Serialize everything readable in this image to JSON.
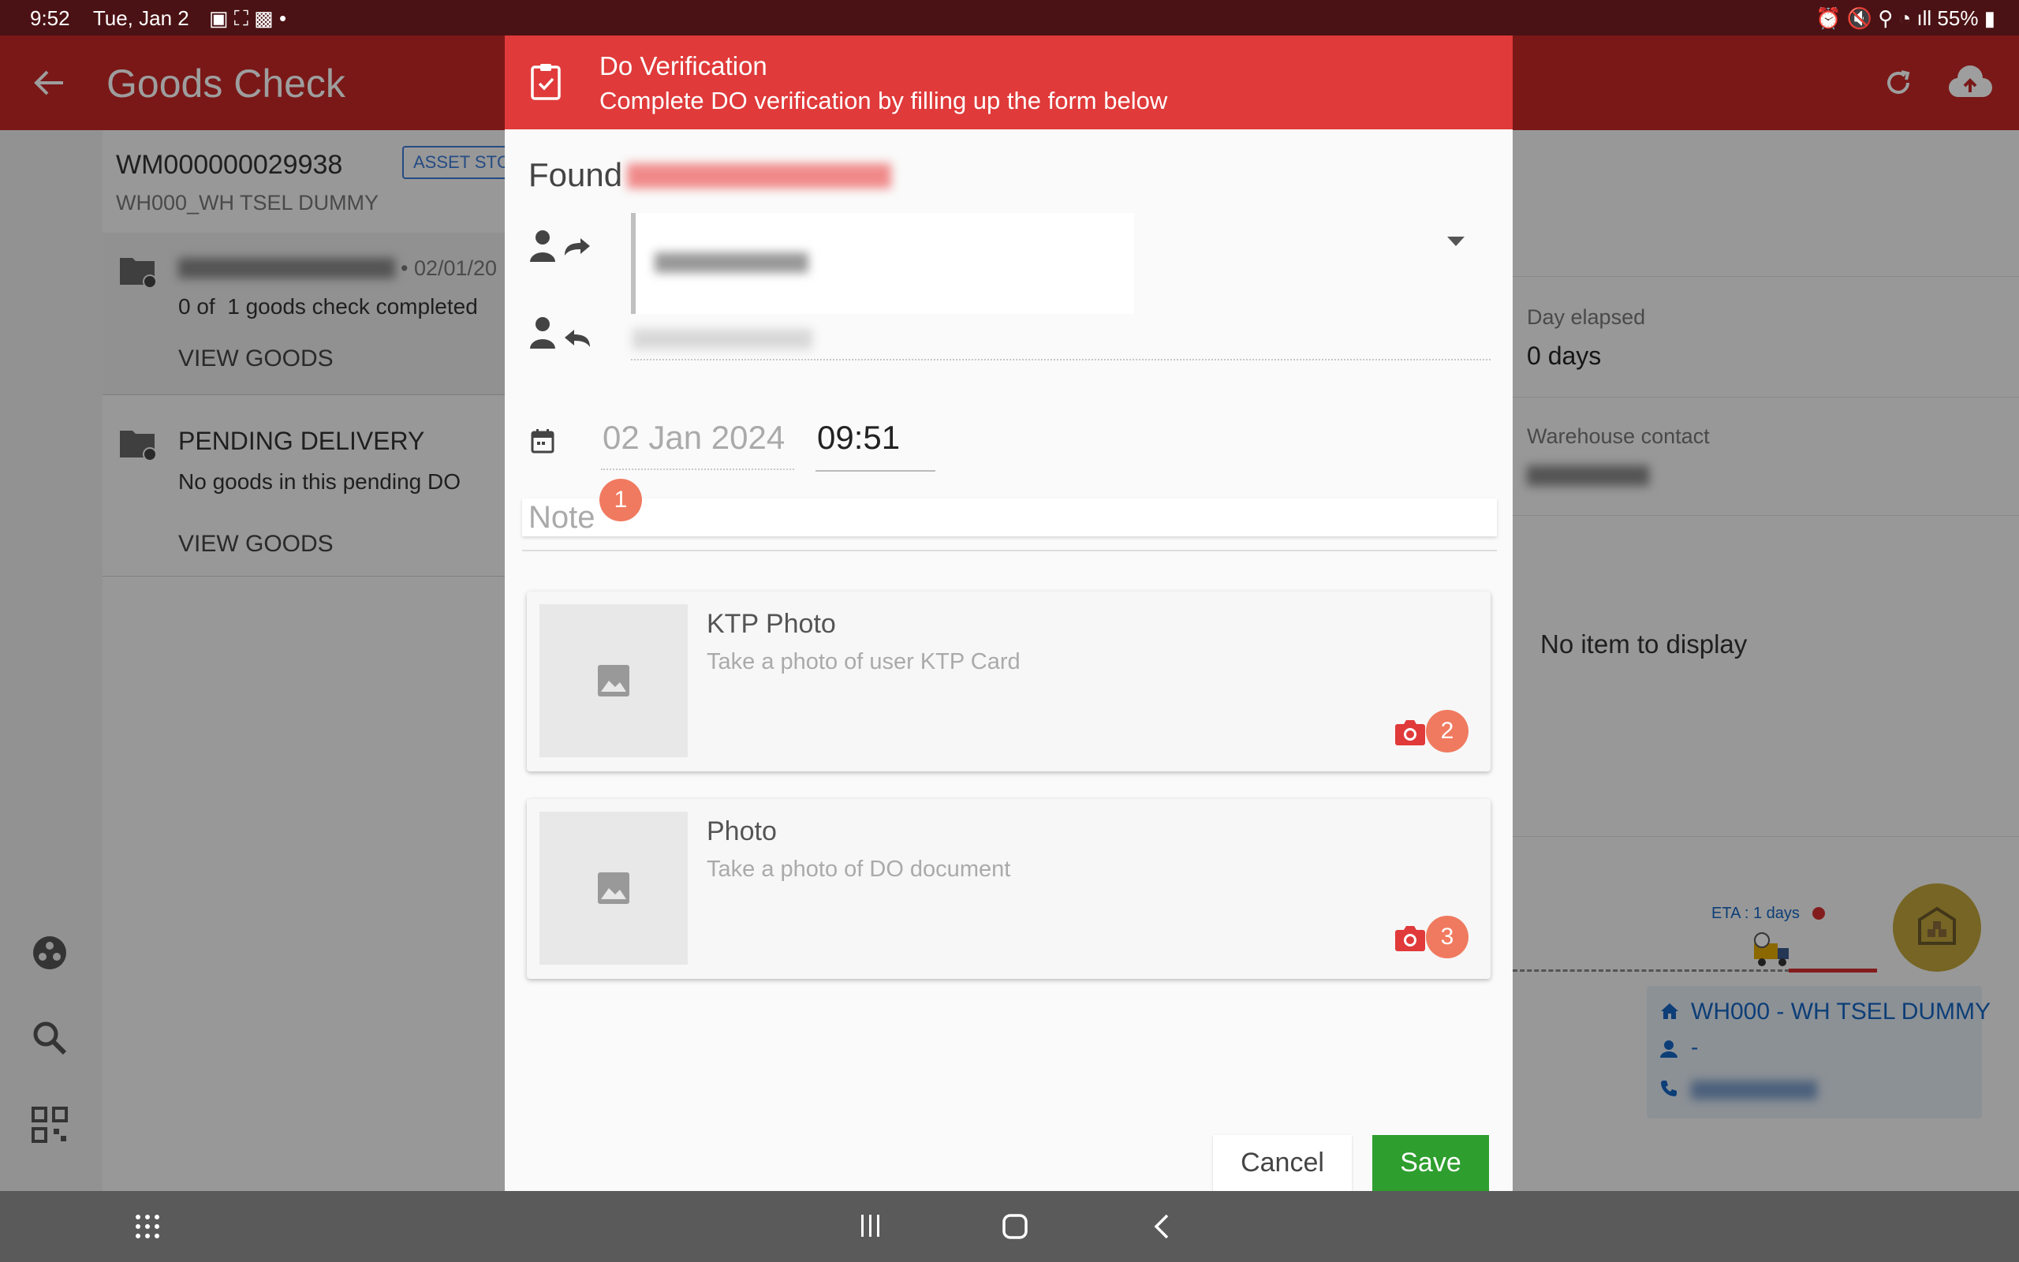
{
  "status_bar": {
    "time": "9:52",
    "date": "Tue, Jan 2",
    "battery": "55%"
  },
  "app_bar": {
    "title": "Goods Check"
  },
  "left_panel": {
    "order_id": "WM000000029938",
    "asset_tag": "ASSET STC",
    "warehouse": "WH000_WH TSEL DUMMY",
    "do_item": {
      "date": "• 02/01/20",
      "progress": "0 of  1 goods check completed",
      "view_goods": "VIEW GOODS"
    },
    "pending": {
      "title": "PENDING DELIVERY",
      "subtitle": "No goods in this pending DO",
      "view_goods": "VIEW GOODS"
    }
  },
  "right_panel": {
    "day_elapsed_label": "Day elapsed",
    "day_elapsed_value": "0 days",
    "warehouse_contact_label": "Warehouse contact",
    "empty_text": "No item to display",
    "eta": "ETA : 1 days",
    "location_name": "WH000 - WH TSEL DUMMY",
    "location_person": "-"
  },
  "dialog": {
    "title": "Do Verification",
    "subtitle": "Complete DO verification by filling up the form below",
    "found_label": "Found",
    "date_value": "02 Jan 2024",
    "time_value": "09:51",
    "note_placeholder": "Note",
    "cards": [
      {
        "title": "KTP Photo",
        "subtitle": "Take a photo of user KTP Card",
        "badge": "2"
      },
      {
        "title": "Photo",
        "subtitle": "Take a photo of DO document",
        "badge": "3"
      }
    ],
    "note_badge": "1",
    "cancel_label": "Cancel",
    "save_label": "Save"
  },
  "colors": {
    "header_red": "#c62828",
    "dialog_header_red": "#e03a3a",
    "save_green": "#2e9e2e",
    "badge_orange": "#f07a5f"
  }
}
